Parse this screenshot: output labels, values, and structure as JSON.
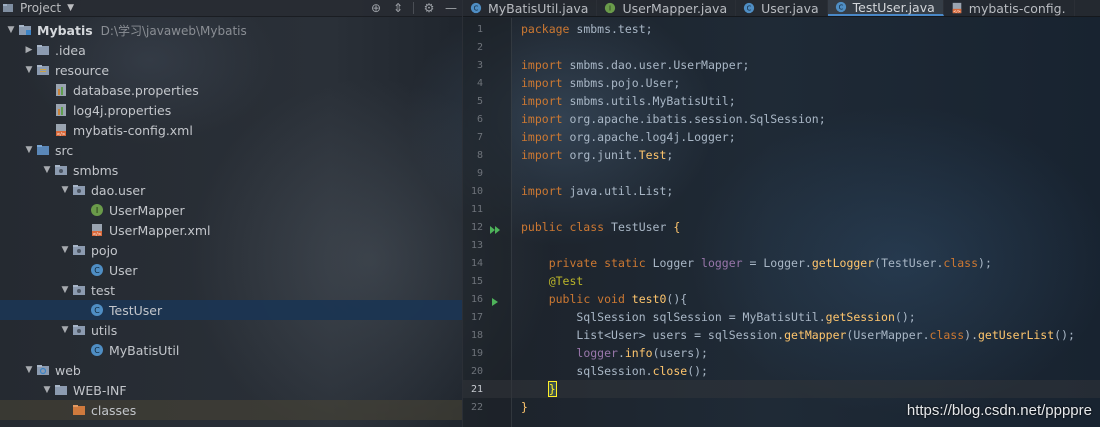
{
  "project_panel": {
    "title": "Project",
    "tree": [
      {
        "label": "Mybatis",
        "path": "D:\\学习\\javaweb\\Mybatis",
        "depth": 0,
        "expanded": true,
        "icon": "module-folder-icon",
        "bold": true
      },
      {
        "label": ".idea",
        "depth": 1,
        "expanded": false,
        "icon": "folder-icon"
      },
      {
        "label": "resource",
        "depth": 1,
        "expanded": true,
        "icon": "resources-folder-icon"
      },
      {
        "label": "database.properties",
        "depth": 2,
        "icon": "properties-file-icon"
      },
      {
        "label": "log4j.properties",
        "depth": 2,
        "icon": "properties-file-icon"
      },
      {
        "label": "mybatis-config.xml",
        "depth": 2,
        "icon": "xml-file-icon"
      },
      {
        "label": "src",
        "depth": 1,
        "expanded": true,
        "icon": "source-folder-icon"
      },
      {
        "label": "smbms",
        "depth": 2,
        "expanded": true,
        "icon": "package-icon"
      },
      {
        "label": "dao.user",
        "depth": 3,
        "expanded": true,
        "icon": "package-icon"
      },
      {
        "label": "UserMapper",
        "depth": 4,
        "icon": "interface-icon"
      },
      {
        "label": "UserMapper.xml",
        "depth": 4,
        "icon": "xml-file-icon"
      },
      {
        "label": "pojo",
        "depth": 3,
        "expanded": true,
        "icon": "package-icon"
      },
      {
        "label": "User",
        "depth": 4,
        "icon": "class-icon"
      },
      {
        "label": "test",
        "depth": 3,
        "expanded": true,
        "icon": "package-icon"
      },
      {
        "label": "TestUser",
        "depth": 4,
        "icon": "class-icon",
        "selected": true
      },
      {
        "label": "utils",
        "depth": 3,
        "expanded": true,
        "icon": "package-icon"
      },
      {
        "label": "MyBatisUtil",
        "depth": 4,
        "icon": "class-icon"
      },
      {
        "label": "web",
        "depth": 1,
        "expanded": true,
        "icon": "web-folder-icon"
      },
      {
        "label": "WEB-INF",
        "depth": 2,
        "expanded": true,
        "icon": "folder-icon"
      },
      {
        "label": "classes",
        "depth": 3,
        "icon": "excluded-folder-icon",
        "highlight": true
      }
    ]
  },
  "tabs": [
    {
      "label": "MyBatisUtil.java",
      "icon": "class-icon"
    },
    {
      "label": "UserMapper.java",
      "icon": "interface-icon"
    },
    {
      "label": "User.java",
      "icon": "class-icon"
    },
    {
      "label": "TestUser.java",
      "icon": "class-icon",
      "active": true
    },
    {
      "label": "mybatis-config.",
      "icon": "xml-file-icon"
    }
  ],
  "editor": {
    "current_line": 21,
    "lines": [
      {
        "n": 1,
        "tokens": [
          [
            "kw",
            "package "
          ],
          [
            "",
            "smbms.test;"
          ]
        ]
      },
      {
        "n": 2,
        "tokens": []
      },
      {
        "n": 3,
        "tokens": [
          [
            "kw",
            "import "
          ],
          [
            "",
            "smbms.dao.user.UserMapper;"
          ]
        ]
      },
      {
        "n": 4,
        "tokens": [
          [
            "kw",
            "import "
          ],
          [
            "",
            "smbms.pojo.User;"
          ]
        ]
      },
      {
        "n": 5,
        "tokens": [
          [
            "kw",
            "import "
          ],
          [
            "",
            "smbms.utils.MyBatisUtil;"
          ]
        ]
      },
      {
        "n": 6,
        "tokens": [
          [
            "kw",
            "import "
          ],
          [
            "",
            "org.apache.ibatis.session.SqlSession;"
          ]
        ]
      },
      {
        "n": 7,
        "tokens": [
          [
            "kw",
            "import "
          ],
          [
            "",
            "org.apache.log4j.Logger;"
          ]
        ]
      },
      {
        "n": 8,
        "tokens": [
          [
            "kw",
            "import "
          ],
          [
            "",
            "org.junit."
          ],
          [
            "mth",
            "Test"
          ],
          [
            "",
            ";"
          ]
        ]
      },
      {
        "n": 9,
        "tokens": []
      },
      {
        "n": 10,
        "tokens": [
          [
            "kw",
            "import "
          ],
          [
            "",
            "java.util.List;"
          ]
        ]
      },
      {
        "n": 11,
        "tokens": []
      },
      {
        "n": 12,
        "tokens": [
          [
            "kw",
            "public class "
          ],
          [
            "",
            "TestUser "
          ],
          [
            "mth",
            "{"
          ]
        ],
        "marker": "run-class-icon"
      },
      {
        "n": 13,
        "tokens": []
      },
      {
        "n": 14,
        "tokens": [
          [
            "",
            "    "
          ],
          [
            "kw",
            "private static "
          ],
          [
            "",
            "Logger "
          ],
          [
            "fld",
            "logger"
          ],
          [
            "",
            " = Logger."
          ],
          [
            "mth",
            "getLogger"
          ],
          [
            "",
            "(TestUser."
          ],
          [
            "kw",
            "class"
          ],
          [
            "",
            ");"
          ]
        ]
      },
      {
        "n": 15,
        "tokens": [
          [
            "",
            "    "
          ],
          [
            "ann",
            "@Test"
          ]
        ]
      },
      {
        "n": 16,
        "tokens": [
          [
            "",
            "    "
          ],
          [
            "kw",
            "public void "
          ],
          [
            "mth",
            "test0"
          ],
          [
            "",
            "(){"
          ]
        ],
        "marker": "run-test-icon"
      },
      {
        "n": 17,
        "tokens": [
          [
            "",
            "        SqlSession sqlSession = MyBatisUtil."
          ],
          [
            "mth",
            "getSession"
          ],
          [
            "",
            "();"
          ]
        ]
      },
      {
        "n": 18,
        "tokens": [
          [
            "",
            "        List<User> users = sqlSession."
          ],
          [
            "mth",
            "getMapper"
          ],
          [
            "",
            "(UserMapper."
          ],
          [
            "kw",
            "class"
          ],
          [
            "",
            ")."
          ],
          [
            "mth",
            "getUserList"
          ],
          [
            "",
            "();"
          ]
        ]
      },
      {
        "n": 19,
        "tokens": [
          [
            "",
            "        "
          ],
          [
            "fld",
            "logger"
          ],
          [
            "",
            "."
          ],
          [
            "mth",
            "info"
          ],
          [
            "",
            "(users);"
          ]
        ]
      },
      {
        "n": 20,
        "tokens": [
          [
            "",
            "        sqlSession."
          ],
          [
            "mth",
            "close"
          ],
          [
            "",
            "();"
          ]
        ]
      },
      {
        "n": 21,
        "tokens": [
          [
            "",
            "    "
          ],
          [
            "caret",
            "}"
          ]
        ]
      },
      {
        "n": 22,
        "tokens": [
          [
            "mth",
            "}"
          ]
        ]
      }
    ]
  },
  "watermark": "https://blog.csdn.net/ppppre",
  "colors": {
    "keyword": "#cc7832",
    "annotation": "#bbb529",
    "field": "#9876aa",
    "method": "#ffc66d",
    "selection": "#1b3552"
  }
}
